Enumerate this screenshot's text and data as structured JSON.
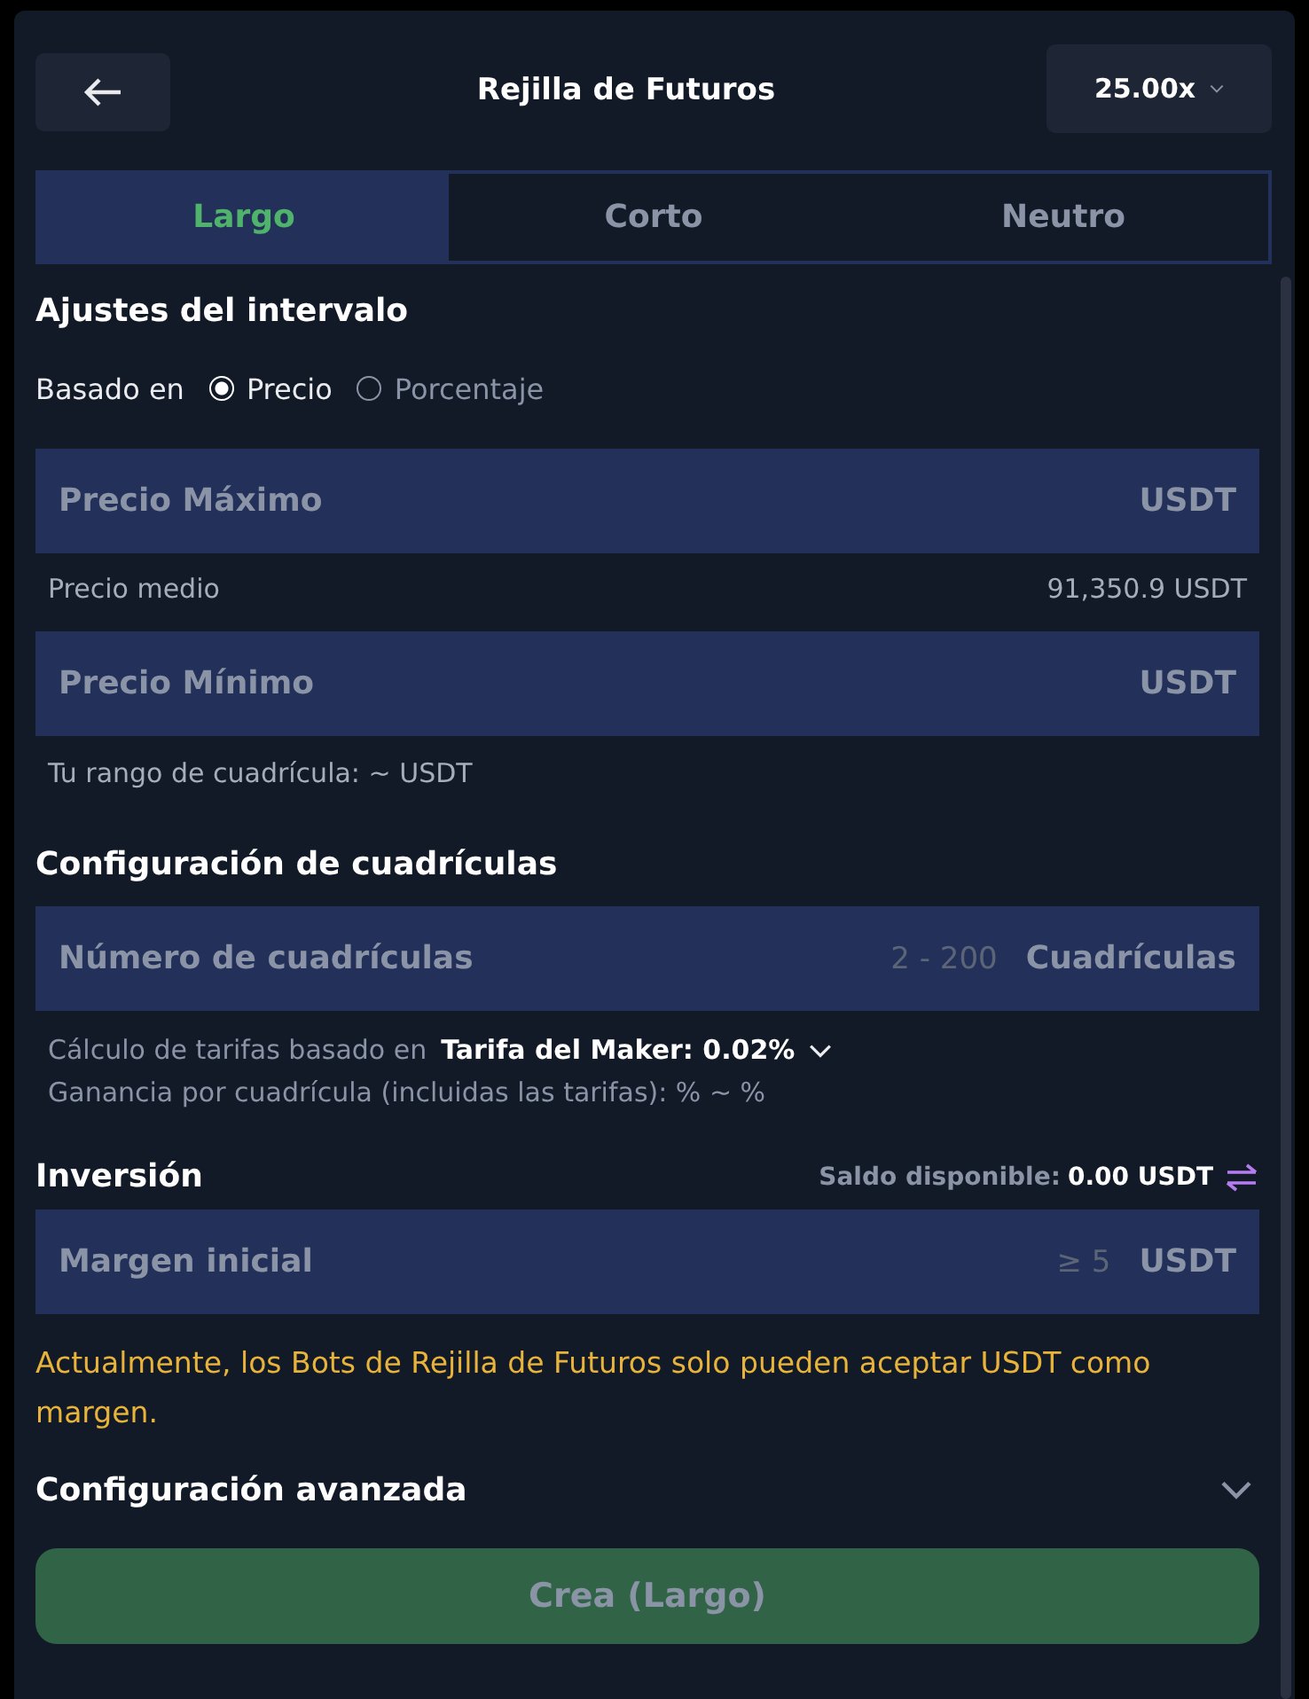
{
  "header": {
    "title": "Rejilla de Futuros",
    "leverage": "25.00x"
  },
  "tabs": [
    {
      "label": "Largo",
      "selected": true
    },
    {
      "label": "Corto",
      "selected": false
    },
    {
      "label": "Neutro",
      "selected": false
    }
  ],
  "range_settings": {
    "title": "Ajustes del intervalo",
    "based_on_label": "Basado en",
    "options": [
      {
        "label": "Precio",
        "selected": true
      },
      {
        "label": "Porcentaje",
        "selected": false
      }
    ],
    "max_field": {
      "placeholder": "Precio Máximo",
      "unit": "USDT"
    },
    "mid_price": {
      "label": "Precio medio",
      "value": "91,350.9 USDT"
    },
    "min_field": {
      "placeholder": "Precio Mínimo",
      "unit": "USDT"
    },
    "range_note": "Tu rango de cuadrícula: ~ USDT"
  },
  "grid_settings": {
    "title": "Configuración de cuadrículas",
    "count_field": {
      "placeholder": "Número de cuadrículas",
      "hint": "2 - 200",
      "unit": "Cuadrículas"
    },
    "fee_label": "Cálculo de tarifas basado en",
    "fee_value": "Tarifa del Maker: 0.02%",
    "profit_note": "Ganancia por cuadrícula (incluidas las tarifas): % ~ %"
  },
  "investment": {
    "title": "Inversión",
    "balance_label": "Saldo disponible:",
    "balance_value": "0.00 USDT",
    "margin_field": {
      "placeholder": "Margen inicial",
      "hint": "≥ 5",
      "unit": "USDT"
    },
    "warning": "Actualmente, los Bots de Rejilla de Futuros solo pueden aceptar USDT como margen."
  },
  "advanced": {
    "title": "Configuración avanzada",
    "expanded": false
  },
  "create_button": {
    "label": "Crea (Largo)",
    "disabled": true
  }
}
